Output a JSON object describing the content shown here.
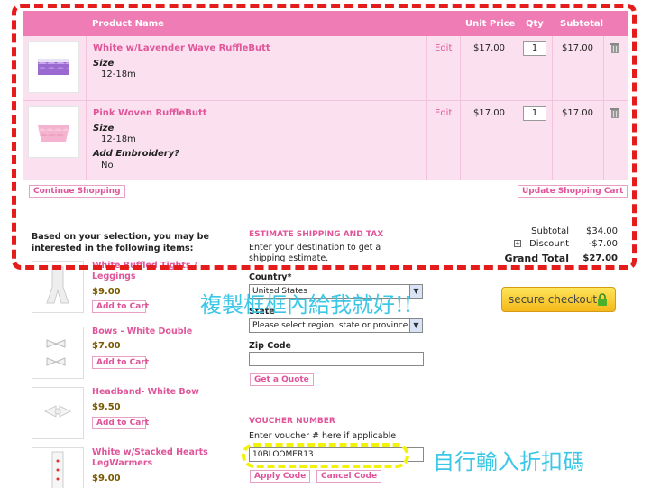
{
  "cart": {
    "headers": {
      "product_name": "Product Name",
      "unit_price": "Unit Price",
      "qty": "Qty",
      "subtotal": "Subtotal"
    },
    "items": [
      {
        "name": "White w/Lavender Wave RuffleButt",
        "option_label": "Size",
        "option_value": "12-18m",
        "edit": "Edit",
        "unit_price": "$17.00",
        "qty": "1",
        "subtotal": "$17.00",
        "image": "lavender-ruffle-bloomer"
      },
      {
        "name": "Pink Woven RuffleButt",
        "option_label": "Size",
        "option_value": "12-18m",
        "option2_label": "Add Embroidery?",
        "option2_value": "No",
        "edit": "Edit",
        "unit_price": "$17.00",
        "qty": "1",
        "subtotal": "$17.00",
        "image": "pink-ruffle-bloomer"
      }
    ],
    "continue_label": "Continue Shopping",
    "update_label": "Update Shopping Cart"
  },
  "recommend": {
    "title": "Based on your selection, you may be interested in the following items:",
    "add_label": "Add to Cart",
    "items": [
      {
        "name": "White Ruffled Tights / Leggings",
        "price": "$9.00"
      },
      {
        "name": "Bows - White Double",
        "price": "$7.00"
      },
      {
        "name": "Headband- White Bow",
        "price": "$9.50"
      },
      {
        "name": "White w/Stacked Hearts LegWarmers",
        "price": "$9.00"
      }
    ]
  },
  "shipping": {
    "title": "ESTIMATE SHIPPING AND TAX",
    "desc": "Enter your destination to get a shipping estimate.",
    "country_label": "Country*",
    "country_value": "United States",
    "state_label": "State",
    "state_value": "Please select region, state or province",
    "zip_label": "Zip Code",
    "zip_value": "",
    "quote_label": "Get a Quote"
  },
  "voucher": {
    "title": "VOUCHER NUMBER",
    "desc": "Enter voucher # here if applicable",
    "value": "10BLOOMER13",
    "apply_label": "Apply Code",
    "cancel_label": "Cancel Code"
  },
  "totals": {
    "subtotal_label": "Subtotal",
    "subtotal_value": "$34.00",
    "discount_label": "Discount",
    "discount_value": "-$7.00",
    "grand_label": "Grand Total",
    "grand_value": "$27.00"
  },
  "checkout": {
    "label": "secure checkout"
  },
  "annotations": {
    "main": "複製框框內給我就好!!",
    "voucher": "自行輸入折扣碼"
  },
  "colors": {
    "pink_accent": "#f07cb6",
    "pink_row": "#fbe1ef",
    "red_dash": "#e51c1c",
    "yellow_dash": "#f3f20a",
    "annotation": "#3cc7e6"
  }
}
